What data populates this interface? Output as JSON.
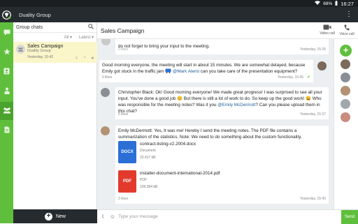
{
  "status": {
    "battery": "68%",
    "time": "16:27"
  },
  "app": {
    "title": "Duality Group",
    "menu_glyph": "⋮"
  },
  "left": {
    "search_label": "Group chats",
    "filter_all": "All",
    "filter_latest": "Latest",
    "chat": {
      "name": "Sales Campaign",
      "sub": "Duality Group",
      "time": "Yesterday, 15:42"
    },
    "new_label": "New"
  },
  "header": {
    "title": "Sales Campaign",
    "video_label": "Video call",
    "voice_label": "Voice call"
  },
  "messages": {
    "m0": {
      "text": "do not forget to bring your input to the meeting.",
      "time": "Yesterday, 15:35",
      "likes": "0 likes"
    },
    "m1": {
      "p1": "Good morning everyone, the meeting will start in about 15 minutes. We are somewhat delayed, because Emily got stuck in the traffic jam",
      "mention": "@Mark Aterio",
      "p2": "can you take care of the presentation equipment?",
      "likes": "0 likes",
      "time": "Yesterday, 15:36"
    },
    "m2": {
      "sender": "Christopher Black:",
      "p1": "Ok! Good morning everyone! We made great progress! I was surprised to see all your input. You've done a good job",
      "p2": "But there is still a lot of work to do. So keep up the good work!",
      "p3": "Who was responsible for the meeting notes? Was it you",
      "mention": "@Emily McDermott",
      "p4": "? Can you please upload them in this chat?",
      "likes": "5 likes",
      "time": "Yesterday, 15:37"
    },
    "m3": {
      "sender": "Emily McDermott:",
      "text": "Yes, It was me! Hereby I send the meeting notes. The PDF file contains a summarization of the statistics. Note: We need to do something about the custom functionality.",
      "likes": "2 likes",
      "time": "Yesterday, 15:40"
    }
  },
  "files": [
    {
      "name": "contract-listing-v2.2004.docx",
      "kind": "Document",
      "size": "22.417 kB",
      "badge": "DOCX",
      "color": "#2b6fd6"
    },
    {
      "name": "installer-document-international-2014.pdf",
      "kind": "PDF",
      "size": "109.394 kB",
      "badge": "PDF",
      "color": "#e23b2e"
    }
  ],
  "composer": {
    "placeholder": "Type your message",
    "send_label": "Send"
  },
  "colors": {
    "accent": "#5fbf3c",
    "dark": "#262b2f",
    "selected": "#fbf6c9"
  }
}
